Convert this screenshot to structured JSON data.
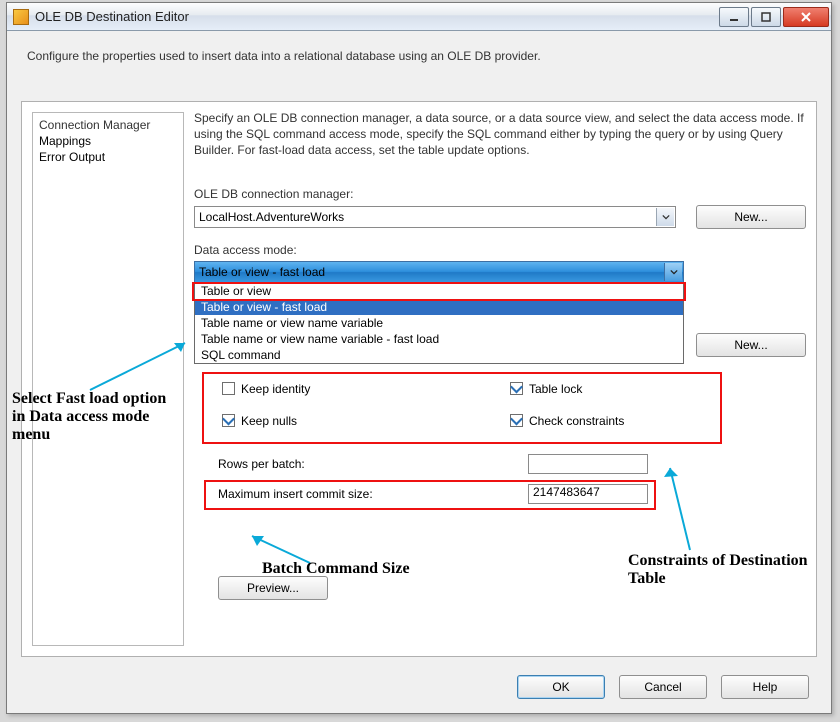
{
  "window": {
    "title": "OLE DB Destination Editor",
    "min_icon": "minimize-icon",
    "max_icon": "maximize-icon",
    "close_label": "X"
  },
  "description": "Configure the properties used to insert data into a relational database using an OLE DB provider.",
  "sidebar": {
    "items": [
      {
        "label": "Connection Manager"
      },
      {
        "label": "Mappings"
      },
      {
        "label": "Error Output"
      }
    ]
  },
  "main": {
    "hint": "Specify an OLE DB connection manager, a data source, or a data source view, and select the data access mode. If using the SQL command access mode, specify the SQL command either by typing the query or by using Query Builder. For fast-load data access, set the table update options.",
    "conn_label": "OLE DB connection manager:",
    "conn_value": "LocalHost.AdventureWorks",
    "new1_label": "New...",
    "mode_label": "Data access mode:",
    "mode_value": "Table or view - fast load",
    "mode_options": [
      "Table or view",
      "Table or view - fast load",
      "Table name or view name variable",
      "Table name or view name variable - fast load",
      "SQL command"
    ],
    "new2_label": "New...",
    "checks": {
      "keep_identity": "Keep identity",
      "table_lock": "Table lock",
      "keep_nulls": "Keep nulls",
      "check_constraints": "Check constraints"
    },
    "rows_label": "Rows per batch:",
    "rows_value": "",
    "max_label": "Maximum insert commit size:",
    "max_value": "2147483647",
    "preview_label": "Preview..."
  },
  "footer": {
    "ok": "OK",
    "cancel": "Cancel",
    "help": "Help"
  },
  "annotations": {
    "fastload": "Select Fast load option in Data access mode menu",
    "batch": "Batch Command Size",
    "constraints": "Constraints of Destination Table"
  }
}
